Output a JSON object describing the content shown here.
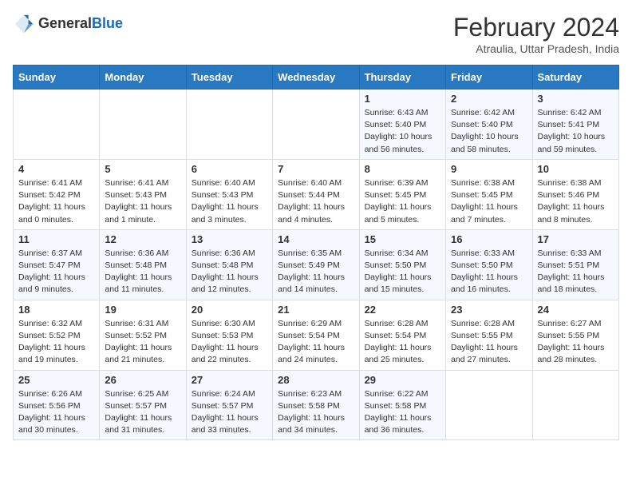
{
  "header": {
    "logo_general": "General",
    "logo_blue": "Blue",
    "month_title": "February 2024",
    "location": "Atraulia, Uttar Pradesh, India"
  },
  "days_of_week": [
    "Sunday",
    "Monday",
    "Tuesday",
    "Wednesday",
    "Thursday",
    "Friday",
    "Saturday"
  ],
  "weeks": [
    [
      null,
      null,
      null,
      null,
      {
        "day": 1,
        "sunrise": "6:43 AM",
        "sunset": "5:40 PM",
        "daylight": "10 hours and 56 minutes."
      },
      {
        "day": 2,
        "sunrise": "6:42 AM",
        "sunset": "5:40 PM",
        "daylight": "10 hours and 58 minutes."
      },
      {
        "day": 3,
        "sunrise": "6:42 AM",
        "sunset": "5:41 PM",
        "daylight": "10 hours and 59 minutes."
      }
    ],
    [
      {
        "day": 4,
        "sunrise": "6:41 AM",
        "sunset": "5:42 PM",
        "daylight": "11 hours and 0 minutes."
      },
      {
        "day": 5,
        "sunrise": "6:41 AM",
        "sunset": "5:43 PM",
        "daylight": "11 hours and 1 minute."
      },
      {
        "day": 6,
        "sunrise": "6:40 AM",
        "sunset": "5:43 PM",
        "daylight": "11 hours and 3 minutes."
      },
      {
        "day": 7,
        "sunrise": "6:40 AM",
        "sunset": "5:44 PM",
        "daylight": "11 hours and 4 minutes."
      },
      {
        "day": 8,
        "sunrise": "6:39 AM",
        "sunset": "5:45 PM",
        "daylight": "11 hours and 5 minutes."
      },
      {
        "day": 9,
        "sunrise": "6:38 AM",
        "sunset": "5:45 PM",
        "daylight": "11 hours and 7 minutes."
      },
      {
        "day": 10,
        "sunrise": "6:38 AM",
        "sunset": "5:46 PM",
        "daylight": "11 hours and 8 minutes."
      }
    ],
    [
      {
        "day": 11,
        "sunrise": "6:37 AM",
        "sunset": "5:47 PM",
        "daylight": "11 hours and 9 minutes."
      },
      {
        "day": 12,
        "sunrise": "6:36 AM",
        "sunset": "5:48 PM",
        "daylight": "11 hours and 11 minutes."
      },
      {
        "day": 13,
        "sunrise": "6:36 AM",
        "sunset": "5:48 PM",
        "daylight": "11 hours and 12 minutes."
      },
      {
        "day": 14,
        "sunrise": "6:35 AM",
        "sunset": "5:49 PM",
        "daylight": "11 hours and 14 minutes."
      },
      {
        "day": 15,
        "sunrise": "6:34 AM",
        "sunset": "5:50 PM",
        "daylight": "11 hours and 15 minutes."
      },
      {
        "day": 16,
        "sunrise": "6:33 AM",
        "sunset": "5:50 PM",
        "daylight": "11 hours and 16 minutes."
      },
      {
        "day": 17,
        "sunrise": "6:33 AM",
        "sunset": "5:51 PM",
        "daylight": "11 hours and 18 minutes."
      }
    ],
    [
      {
        "day": 18,
        "sunrise": "6:32 AM",
        "sunset": "5:52 PM",
        "daylight": "11 hours and 19 minutes."
      },
      {
        "day": 19,
        "sunrise": "6:31 AM",
        "sunset": "5:52 PM",
        "daylight": "11 hours and 21 minutes."
      },
      {
        "day": 20,
        "sunrise": "6:30 AM",
        "sunset": "5:53 PM",
        "daylight": "11 hours and 22 minutes."
      },
      {
        "day": 21,
        "sunrise": "6:29 AM",
        "sunset": "5:54 PM",
        "daylight": "11 hours and 24 minutes."
      },
      {
        "day": 22,
        "sunrise": "6:28 AM",
        "sunset": "5:54 PM",
        "daylight": "11 hours and 25 minutes."
      },
      {
        "day": 23,
        "sunrise": "6:28 AM",
        "sunset": "5:55 PM",
        "daylight": "11 hours and 27 minutes."
      },
      {
        "day": 24,
        "sunrise": "6:27 AM",
        "sunset": "5:55 PM",
        "daylight": "11 hours and 28 minutes."
      }
    ],
    [
      {
        "day": 25,
        "sunrise": "6:26 AM",
        "sunset": "5:56 PM",
        "daylight": "11 hours and 30 minutes."
      },
      {
        "day": 26,
        "sunrise": "6:25 AM",
        "sunset": "5:57 PM",
        "daylight": "11 hours and 31 minutes."
      },
      {
        "day": 27,
        "sunrise": "6:24 AM",
        "sunset": "5:57 PM",
        "daylight": "11 hours and 33 minutes."
      },
      {
        "day": 28,
        "sunrise": "6:23 AM",
        "sunset": "5:58 PM",
        "daylight": "11 hours and 34 minutes."
      },
      {
        "day": 29,
        "sunrise": "6:22 AM",
        "sunset": "5:58 PM",
        "daylight": "11 hours and 36 minutes."
      },
      null,
      null
    ]
  ]
}
